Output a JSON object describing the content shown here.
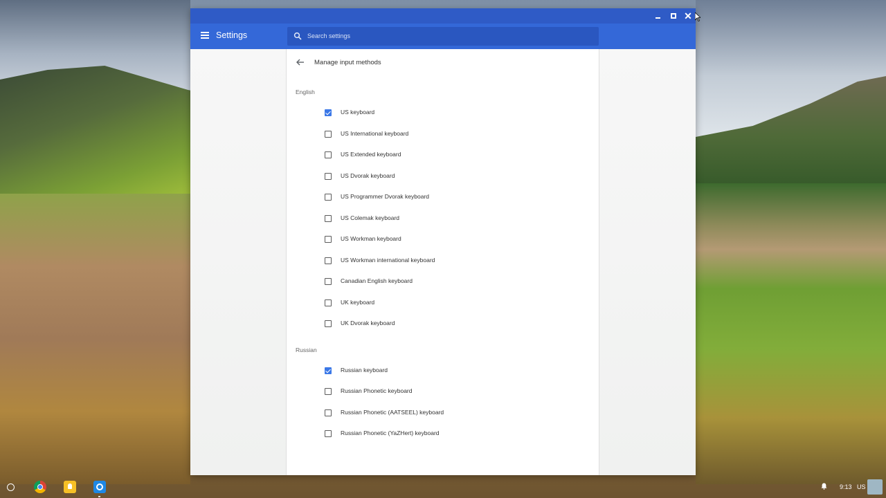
{
  "window": {
    "app_title": "Settings",
    "controls": [
      "minimize-icon",
      "maximize-icon",
      "close-icon"
    ],
    "close_glyph": "✕"
  },
  "search": {
    "placeholder": "Search settings"
  },
  "page": {
    "title": "Manage input methods",
    "sections": [
      {
        "label": "English",
        "items": [
          {
            "label": "US keyboard",
            "checked": true
          },
          {
            "label": "US International keyboard",
            "checked": false
          },
          {
            "label": "US Extended keyboard",
            "checked": false
          },
          {
            "label": "US Dvorak keyboard",
            "checked": false
          },
          {
            "label": "US Programmer Dvorak keyboard",
            "checked": false
          },
          {
            "label": "US Colemak keyboard",
            "checked": false
          },
          {
            "label": "US Workman keyboard",
            "checked": false
          },
          {
            "label": "US Workman international keyboard",
            "checked": false
          },
          {
            "label": "Canadian English keyboard",
            "checked": false
          },
          {
            "label": "UK keyboard",
            "checked": false
          },
          {
            "label": "UK Dvorak keyboard",
            "checked": false
          }
        ]
      },
      {
        "label": "Russian",
        "items": [
          {
            "label": "Russian keyboard",
            "checked": true
          },
          {
            "label": "Russian Phonetic keyboard",
            "checked": false
          },
          {
            "label": "Russian Phonetic (AATSEEL) keyboard",
            "checked": false
          },
          {
            "label": "Russian Phonetic (YaZHert) keyboard",
            "checked": false
          }
        ]
      }
    ]
  },
  "shelf": {
    "apps": [
      "launcher-icon",
      "chrome-icon",
      "keep-icon",
      "settings-icon"
    ],
    "time": "9:13",
    "input_method": "US"
  },
  "colors": {
    "titlebar": "#2f5bc6",
    "toolbar": "#3468d8",
    "checkbox_checked": "#3b78e7"
  }
}
